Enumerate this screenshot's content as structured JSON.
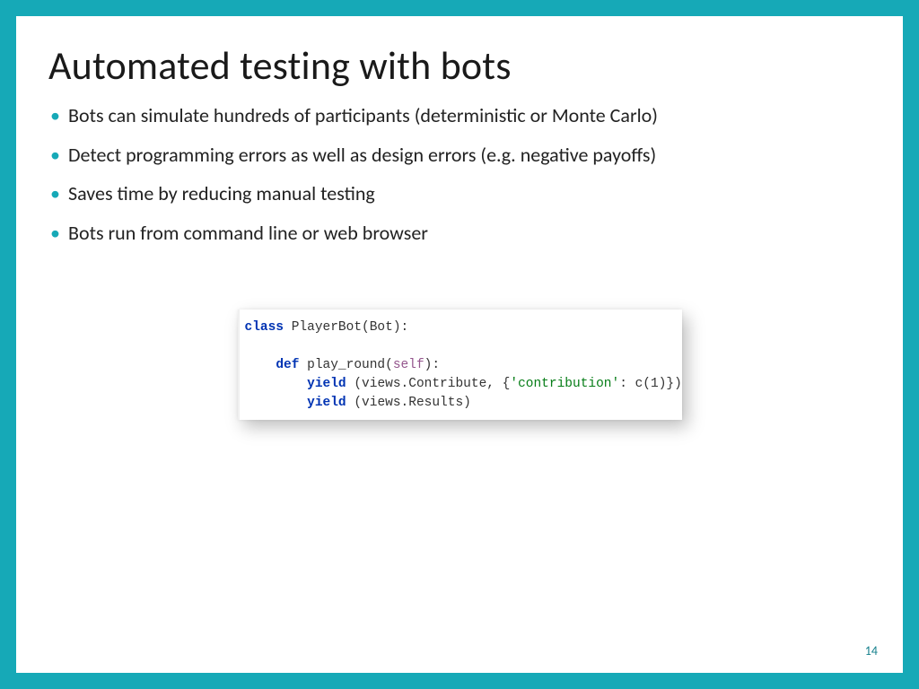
{
  "title": "Automated testing with bots",
  "bullets": [
    "Bots can simulate hundreds of participants (deterministic or Monte Carlo)",
    "Detect programming errors as well as design errors (e.g. negative payoffs)",
    "Saves time by reducing manual testing",
    "Bots run from command line or web browser"
  ],
  "code": {
    "kw_class": "class",
    "class_decl": " PlayerBot(Bot):",
    "kw_def": "def",
    "fn_decl": " play_round(",
    "self": "self",
    "fn_close": "):",
    "kw_yield1": "yield",
    "yield1_a": " (views.Contribute, {",
    "yield1_str": "'contribution'",
    "yield1_b": ": c(1)})",
    "kw_yield2": "yield",
    "yield2_a": " (views.Results)"
  },
  "page_number": "14"
}
